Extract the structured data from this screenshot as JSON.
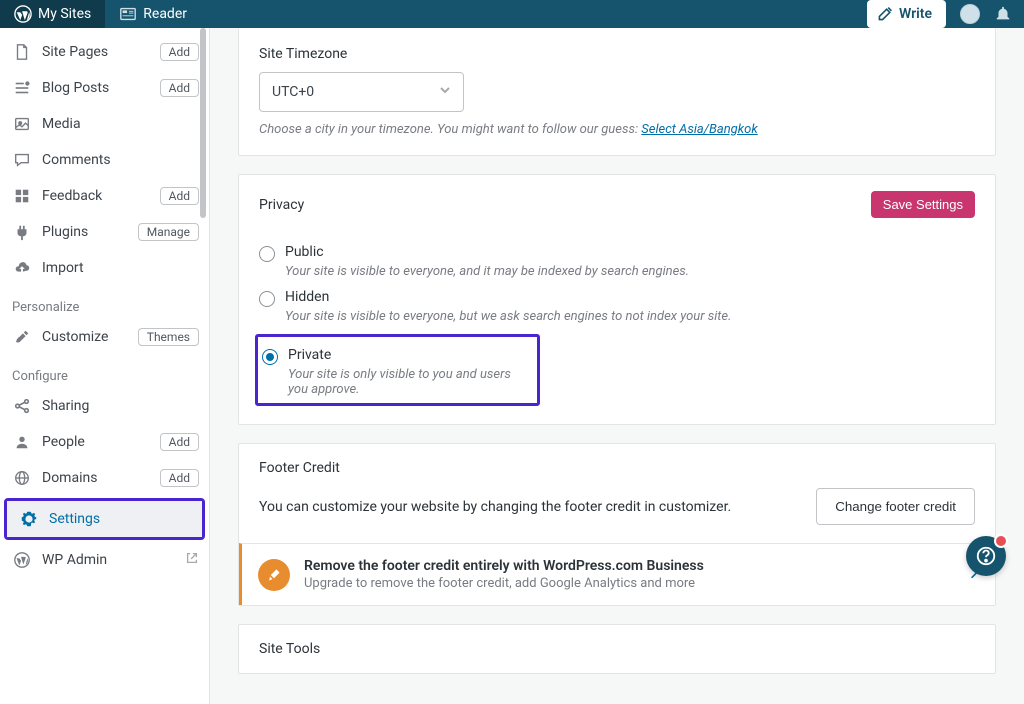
{
  "topbar": {
    "my_sites": "My Sites",
    "reader": "Reader",
    "write": "Write"
  },
  "sidebar": {
    "items": [
      {
        "label": "Site Pages",
        "pill": "Add",
        "icon": "pages"
      },
      {
        "label": "Blog Posts",
        "pill": "Add",
        "icon": "posts"
      },
      {
        "label": "Media",
        "pill": null,
        "icon": "media"
      },
      {
        "label": "Comments",
        "pill": null,
        "icon": "comments"
      },
      {
        "label": "Feedback",
        "pill": "Add",
        "icon": "feedback"
      },
      {
        "label": "Plugins",
        "pill": "Manage",
        "icon": "plugins"
      },
      {
        "label": "Import",
        "pill": null,
        "icon": "import"
      }
    ],
    "group_personalize": "Personalize",
    "personalize": [
      {
        "label": "Customize",
        "pill": "Themes",
        "icon": "customize"
      }
    ],
    "group_configure": "Configure",
    "configure": [
      {
        "label": "Sharing",
        "pill": null,
        "icon": "sharing"
      },
      {
        "label": "People",
        "pill": "Add",
        "icon": "people"
      },
      {
        "label": "Domains",
        "pill": "Add",
        "icon": "domains"
      },
      {
        "label": "Settings",
        "pill": null,
        "icon": "settings"
      },
      {
        "label": "WP Admin",
        "pill": null,
        "icon": "wpadmin",
        "external": true
      }
    ]
  },
  "timezone": {
    "label": "Site Timezone",
    "value": "UTC+0",
    "helper_prefix": "Choose a city in your timezone. You might want to follow our guess: ",
    "helper_link": "Select Asia/Bangkok"
  },
  "privacy": {
    "title": "Privacy",
    "save": "Save Settings",
    "options": [
      {
        "label": "Public",
        "desc": "Your site is visible to everyone, and it may be indexed by search engines.",
        "checked": false
      },
      {
        "label": "Hidden",
        "desc": "Your site is visible to everyone, but we ask search engines to not index your site.",
        "checked": false
      },
      {
        "label": "Private",
        "desc": "Your site is only visible to you and users you approve.",
        "checked": true
      }
    ]
  },
  "footer_credit": {
    "title": "Footer Credit",
    "desc": "You can customize your website by changing the footer credit in customizer.",
    "button": "Change footer credit",
    "upsell_title": "Remove the footer credit entirely with WordPress.com Business",
    "upsell_desc": "Upgrade to remove the footer credit, add Google Analytics and more"
  },
  "site_tools": {
    "title": "Site Tools"
  }
}
